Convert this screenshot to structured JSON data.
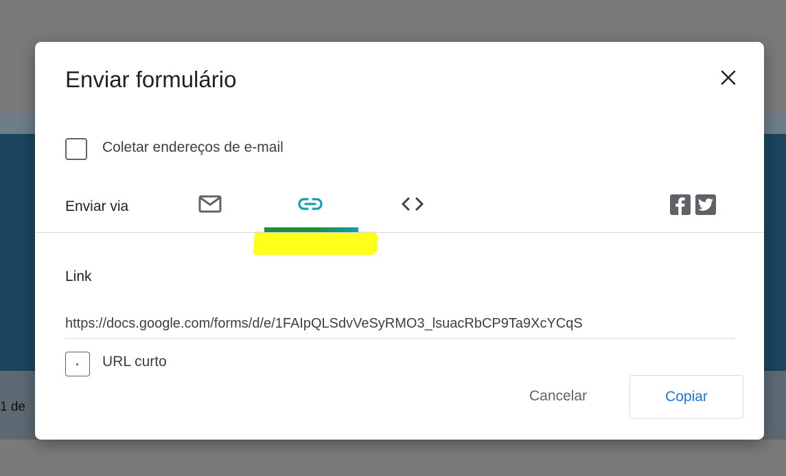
{
  "background": {
    "page_indicator": "1 de"
  },
  "dialog": {
    "title": "Enviar formulário",
    "close_icon": "close-icon",
    "collect_emails": {
      "label": "Coletar endereços de e-mail",
      "checked": false
    },
    "send_via": {
      "label": "Enviar via",
      "tabs": [
        {
          "name": "email",
          "icon": "mail-icon",
          "selected": false
        },
        {
          "name": "link",
          "icon": "link-icon",
          "selected": true
        },
        {
          "name": "embed",
          "icon": "code-icon",
          "selected": false
        }
      ],
      "share": [
        {
          "name": "facebook",
          "icon": "facebook-icon"
        },
        {
          "name": "twitter",
          "icon": "twitter-icon"
        }
      ]
    },
    "link_section": {
      "heading": "Link",
      "url": "https://docs.google.com/forms/d/e/1FAIpQLSdvVeSyRMO3_lsuacRbCP9Ta9XcYCqS",
      "short_url": {
        "label": "URL curto",
        "checked": false
      }
    },
    "actions": {
      "cancel_label": "Cancelar",
      "copy_label": "Copiar"
    }
  },
  "colors": {
    "accent": "#1a73e8",
    "tab_indicator": "#129eaf",
    "highlight": "#ffff1a",
    "icon_gray": "#5f6368"
  }
}
